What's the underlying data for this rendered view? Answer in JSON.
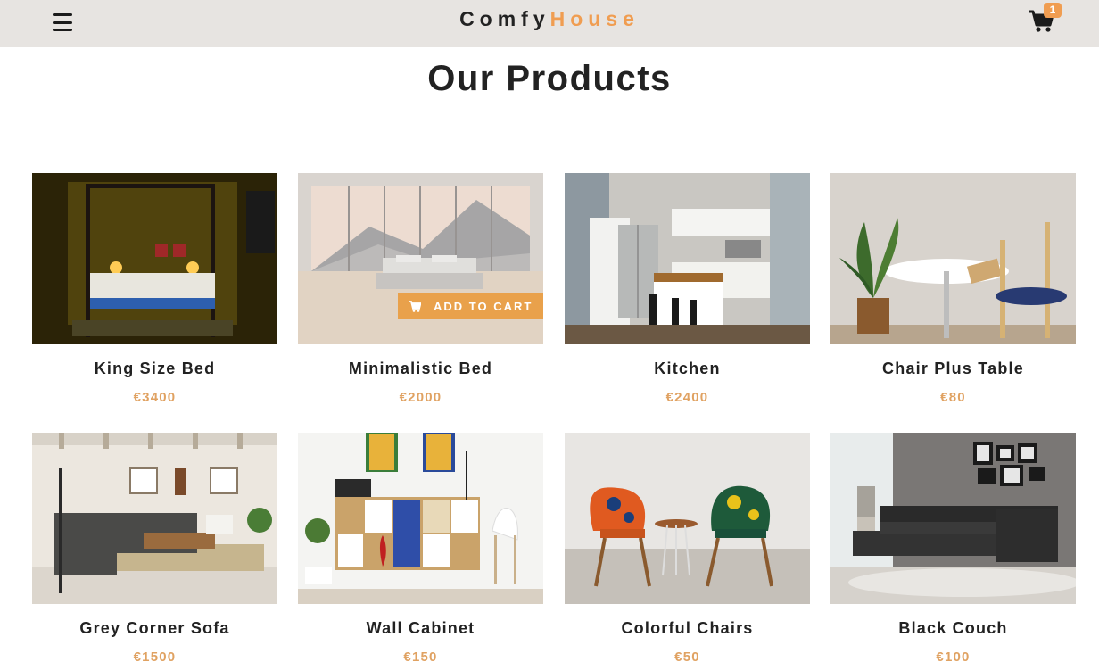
{
  "navbar": {
    "logo_part1": "Comfy",
    "logo_part2": "House",
    "cart_count": "1",
    "icons": {
      "menu": "menu-icon",
      "cart": "cart-icon"
    }
  },
  "products_section": {
    "title": "Our Products",
    "add_to_cart_label": "ADD TO CART"
  },
  "products": [
    {
      "name": "King Size Bed",
      "price": "€3400"
    },
    {
      "name": "Minimalistic Bed",
      "price": "€2000"
    },
    {
      "name": "Kitchen",
      "price": "€2400"
    },
    {
      "name": "Chair Plus Table",
      "price": "€80"
    },
    {
      "name": "Grey Corner Sofa",
      "price": "€1500"
    },
    {
      "name": "Wall Cabinet",
      "price": "€150"
    },
    {
      "name": "Colorful Chairs",
      "price": "€50"
    },
    {
      "name": "Black Couch",
      "price": "€100"
    }
  ],
  "colors": {
    "accent": "#f09d51",
    "navbar_bg": "#e7e4e1",
    "price": "#e0a262"
  }
}
